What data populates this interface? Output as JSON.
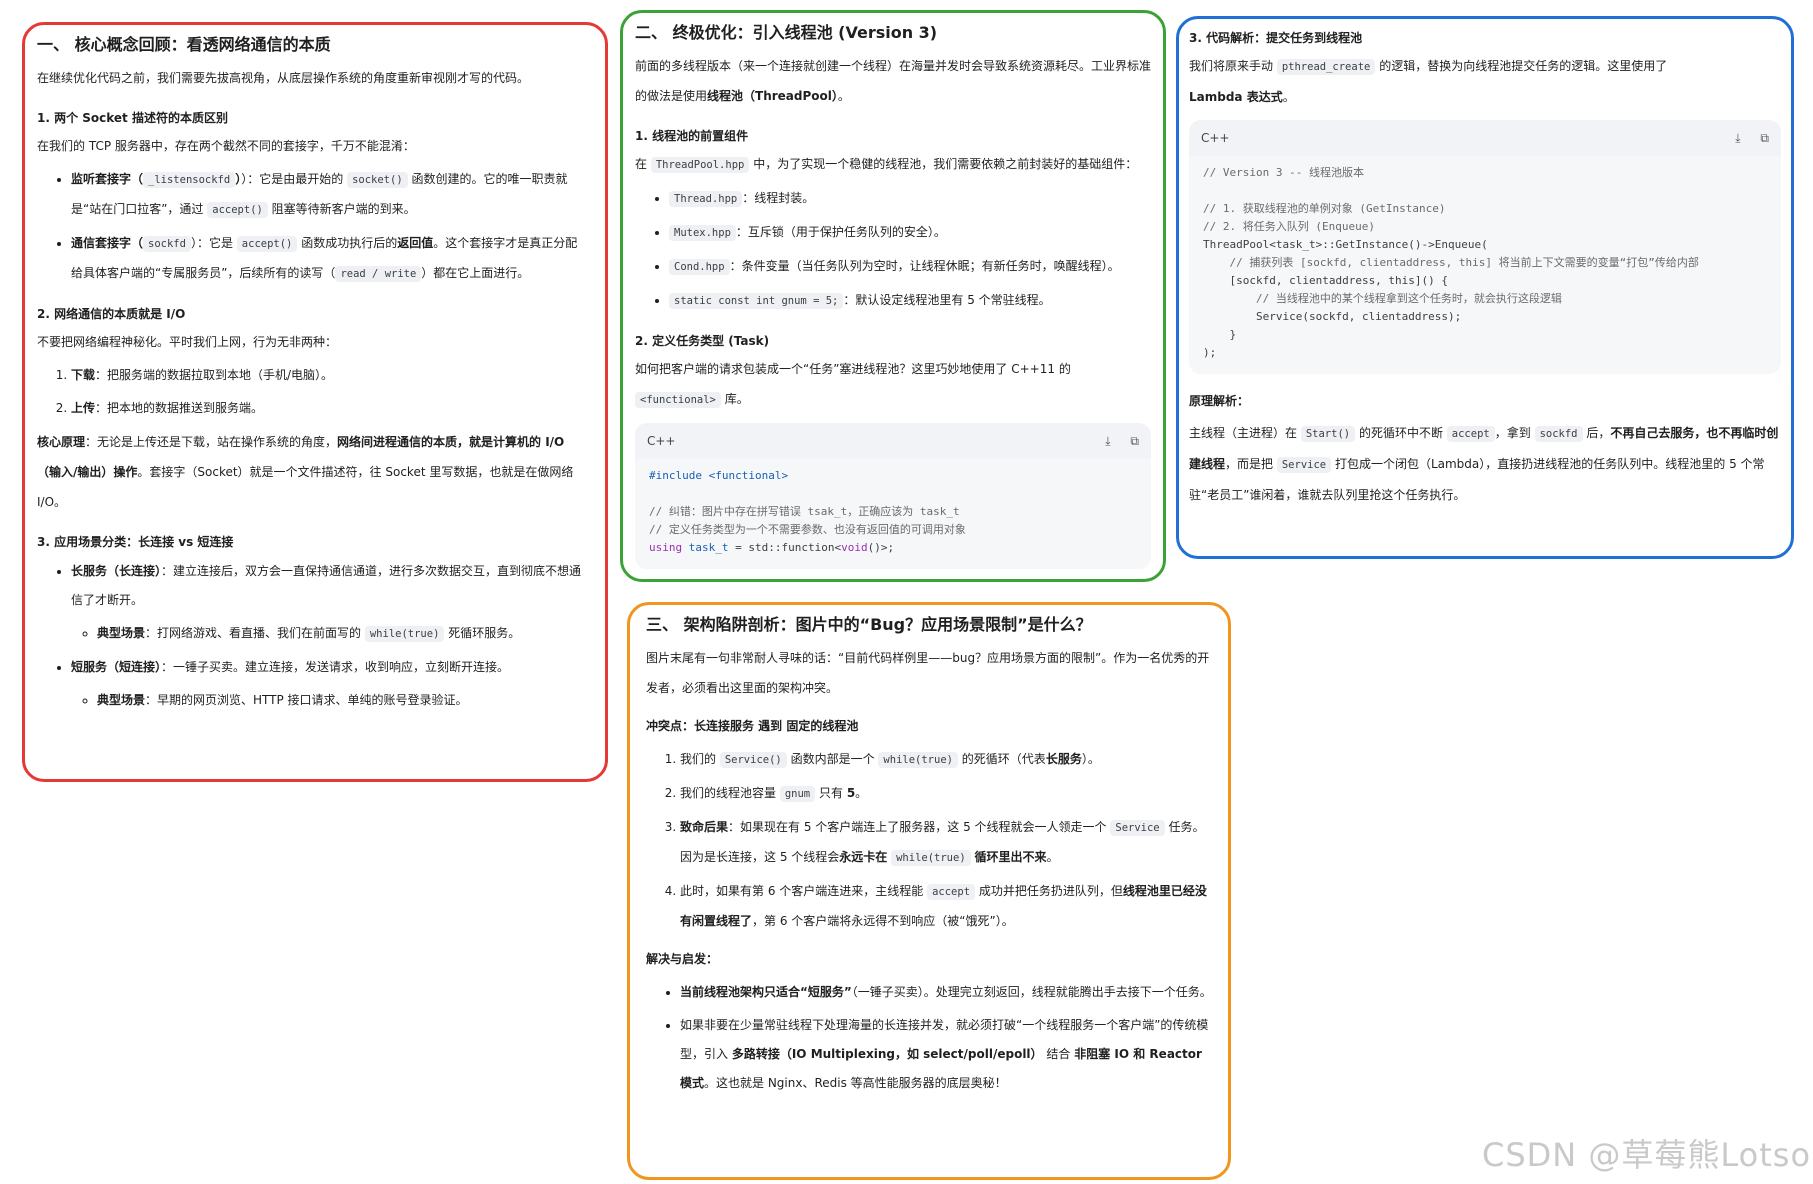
{
  "s1": {
    "title": "一、 核心概念回顾：看透网络通信的本质",
    "intro": "在继续优化代码之前，我们需要先拔高视角，从底层操作系统的角度重新审视刚才写的代码。",
    "h1": "1. 两个 Socket 描述符的本质区别",
    "p1": "在我们的 TCP 服务器中，存在两个截然不同的套接字，千万不能混淆：",
    "li1_label": "监听套接字（",
    "li1_code": "_listensockfd",
    "li1_mid": "）：它是由最开始的",
    "li1_code2": "socket()",
    "li1_text": "函数创建的。它的唯一职责就是“站在门口拉客”，通过",
    "li1_code3": "accept()",
    "li1_tail": "阻塞等待新客户端的到来。",
    "li2_label": "通信套接字（",
    "li2_code": "sockfd",
    "li2_mid": "）：它是",
    "li2_code2": "accept()",
    "li2_text": "函数成功执行后的",
    "li2_bold": "返回值",
    "li2_text2": "。这个套接字才是真正分配给具体客户端的“专属服务员”，后续所有的读写（",
    "li2_code3": "read / write",
    "li2_tail": "）都在它上面进行。",
    "h2": "2. 网络通信的本质就是 I/O",
    "p2": "不要把网络编程神秘化。平时我们上网，行为无非两种：",
    "ol1_b": "下载",
    "ol1_t": "：把服务端的数据拉取到本地（手机/电脑）。",
    "ol2_b": "上传",
    "ol2_t": "：把本地的数据推送到服务端。",
    "core_b": "核心原理",
    "core_t1": "：无论是上传还是下载，站在操作系统的角度，",
    "core_b2": "网络间进程通信的本质，就是计算机的 I/O（输入/输出）操作",
    "core_t2": "。套接字（Socket）就是一个文件描述符，往 Socket 里写数据，也就是在做网络 I/O。",
    "h3": "3. 应用场景分类：长连接 vs 短连接",
    "long_b": "长服务（长连接）",
    "long_t": "：建立连接后，双方会一直保持通信通道，进行多次数据交互，直到彻底不想通信了才断开。",
    "long_sub_b": "典型场景",
    "long_sub_t": "：打网络游戏、看直播、我们在前面写的",
    "long_sub_code": "while(true)",
    "long_sub_tail": "死循环服务。",
    "short_b": "短服务（短连接）",
    "short_t": "：一锤子买卖。建立连接，发送请求，收到响应，立刻断开连接。",
    "short_sub_b": "典型场景",
    "short_sub_t": "：早期的网页浏览、HTTP 接口请求、单纯的账号登录验证。"
  },
  "s2": {
    "title": "二、 终极优化：引入线程池 (Version 3)",
    "intro1": "前面的多线程版本（来一个连接就创建一个线程）在海量并发时会导致系统资源耗尽。工业界标准的做法是使用",
    "intro_b": "线程池（ThreadPool）",
    "intro2": "。",
    "h1": "1. 线程池的前置组件",
    "p1a": "在",
    "p1_code": "ThreadPool.hpp",
    "p1b": "中，为了实现一个稳健的线程池，我们需要依赖之前封装好的基础组件：",
    "items": [
      {
        "code": "Thread.hpp",
        "text": "：线程封装。"
      },
      {
        "code": "Mutex.hpp",
        "text": "：互斥锁（用于保护任务队列的安全）。"
      },
      {
        "code": "Cond.hpp",
        "text": "：条件变量（当任务队列为空时，让线程休眠；有新任务时，唤醒线程）。"
      },
      {
        "code": "static const int gnum = 5;",
        "text": "：默认设定线程池里有 5 个常驻线程。"
      }
    ],
    "h2": "2. 定义任务类型 (Task)",
    "p2a": "如何把客户端的请求包装成一个“任务”塞进线程池？这里巧妙地使用了 C++11 的",
    "p2_code": "<functional>",
    "p2b": "库。",
    "code_lang": "C++",
    "code_l1_kw": "#include",
    "code_l1_ty": "<functional>",
    "code_l2": "// 纠错：图片中存在拼写错误 tsak_t，正确应该为 task_t",
    "code_l3": "// 定义任务类型为一个不需要参数、也没有返回值的可调用对象",
    "code_l4_kw": "using",
    "code_l4_ty": "task_t",
    "code_l4_rest": " = std::function<",
    "code_l4_kw2": "void",
    "code_l4_end": "()>;"
  },
  "s3": {
    "title": "3. 代码解析：提交任务到线程池",
    "p1a": "我们将原来手动",
    "p1_code": "pthread_create",
    "p1b": "的逻辑，替换为向线程池提交任务的逻辑。这里使用了",
    "p1_bold": "Lambda 表达式",
    "p1c": "。",
    "code_lang": "C++",
    "code_lines": [
      "// Version 3 -- 线程池版本",
      "",
      "// 1. 获取线程池的单例对象 (GetInstance)",
      "// 2. 将任务入队列 (Enqueue)",
      "ThreadPool<task_t>::GetInstance()->Enqueue(",
      "    // 捕获列表 [sockfd, clientaddress, this] 将当前上下文需要的变量“打包”传给内部",
      "    [sockfd, clientaddress, this]() {",
      "        // 当线程池中的某个线程拿到这个任务时，就会执行这段逻辑",
      "        Service(sockfd, clientaddress);",
      "    }",
      ");"
    ],
    "principle": "原理解析",
    "pp_a": "主线程（主进程）在",
    "pp_code1": "Start()",
    "pp_b": "的死循环中不断",
    "pp_code2": "accept",
    "pp_c": "，拿到",
    "pp_code3": "sockfd",
    "pp_d": "后，",
    "pp_bold": "不再自己去服务，也不再临时创建线程",
    "pp_e": "，而是把",
    "pp_code4": "Service",
    "pp_f": "打包成一个闭包（Lambda），直接扔进线程池的任务队列中。线程池里的 5 个常驻“老员工”谁闲着，谁就去队列里抢这个任务执行。"
  },
  "s4": {
    "title": "三、 架构陷阱剖析：图片中的“Bug？应用场景限制”是什么？",
    "intro": "图片末尾有一句非常耐人寻味的话：“目前代码样例里——bug？应用场景方面的限制”。作为一名优秀的开发者，必须看出这里面的架构冲突。",
    "conflict": "冲突点：长连接服务 遇到 固定的线程池",
    "o1a": "我们的",
    "o1_code": "Service()",
    "o1b": "函数内部是一个",
    "o1_code2": "while(true)",
    "o1c": "的死循环（代表",
    "o1_bold": "长服务",
    "o1d": "）。",
    "o2a": "我们的线程池容量",
    "o2_code": "gnum",
    "o2b": "只有",
    "o2_bold": "5",
    "o2c": "。",
    "o3_bold": "致命后果",
    "o3a": "：如果现在有 5 个客户端连上了服务器，这 5 个线程就会一人领走一个",
    "o3_code": "Service",
    "o3b": "任务。因为是长连接，这 5 个线程会",
    "o3_bold2": "永远卡在",
    "o3_code2": "while(true)",
    "o3_bold3": "循环里出不来",
    "o3c": "。",
    "o4a": "此时，如果有第 6 个客户端连进来，主线程能",
    "o4_code": "accept",
    "o4b": "成功并把任务扔进队列，但",
    "o4_bold": "线程池里已经没有闲置线程了",
    "o4c": "，第 6 个客户端将永远得不到响应（被“饿死”）。",
    "solution": "解决与启发",
    "s1_bold": "当前线程池架构只适合“短服务”",
    "s1_t": "（一锤子买卖）。处理完立刻返回，线程就能腾出手去接下一个任务。",
    "s2_t1": "如果非要在少量常驻线程下处理海量的长连接并发，就必须打破“一个线程服务一个客户端”的传统模型，引入",
    "s2_b1": "多路转接（IO Multiplexing，如 select/poll/epoll）",
    "s2_t2": "结合",
    "s2_b2": "非阻塞 IO 和 Reactor 模式",
    "s2_t3": "。这也就是 Nginx、Redis 等高性能服务器的底层奥秘！"
  },
  "watermark": "CSDN @草莓熊Lotso",
  "icons": [
    "download-icon",
    "copy-icon"
  ],
  "colors": {
    "red": "#e53935",
    "green": "#3aa335",
    "blue": "#1f6fd6",
    "orange": "#f0951e"
  }
}
